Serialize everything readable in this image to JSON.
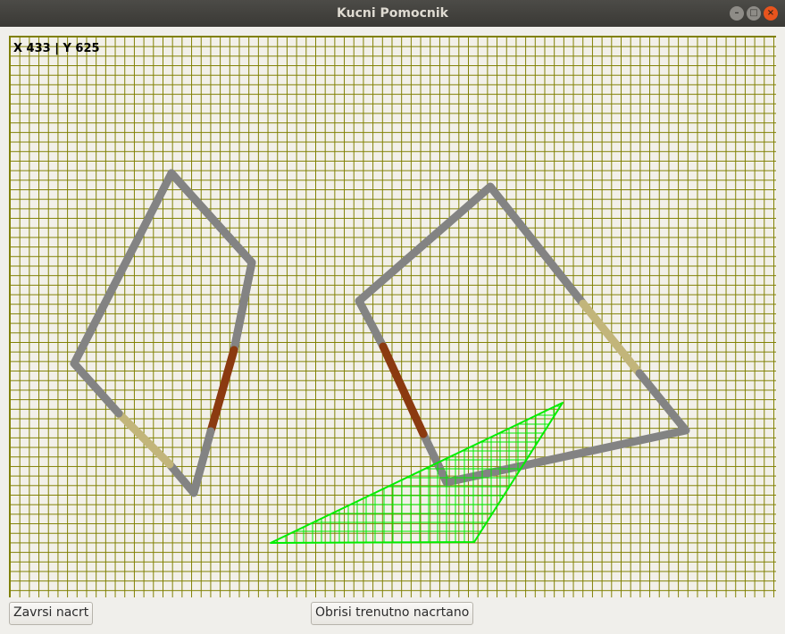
{
  "window": {
    "title": "Kucni Pomocnik"
  },
  "canvas": {
    "coords_text": "X 433 | Y 625"
  },
  "buttons": {
    "finish_label": "Zavrsi nacrt",
    "clear_label": "Obrisi trenutno nacrtano"
  },
  "colors": {
    "wall": "#838383",
    "door": "#8b3a10",
    "window": "#c2b57a",
    "current_shape": "#00ee00",
    "grid": "#7f7f00"
  },
  "icons": [
    "minimize-icon",
    "maximize-icon",
    "close-icon"
  ]
}
